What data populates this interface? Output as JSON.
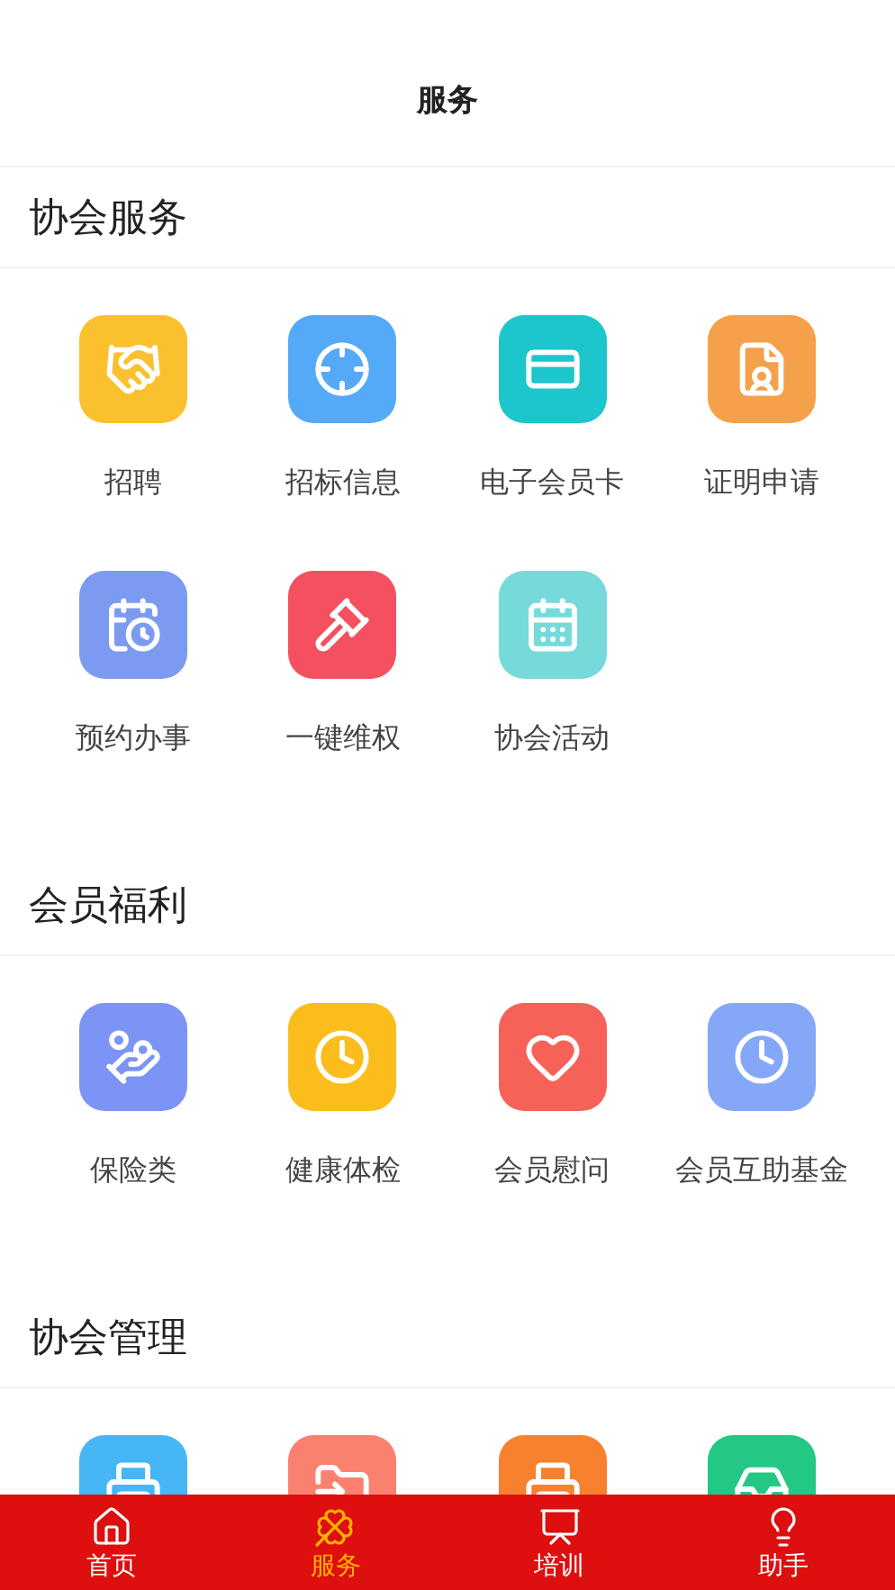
{
  "header": {
    "title": "服务"
  },
  "sections": [
    {
      "title": "协会服务",
      "items": [
        {
          "label": "招聘",
          "color": "#fbc02d"
        },
        {
          "label": "招标信息",
          "color": "#55aaf7"
        },
        {
          "label": "电子会员卡",
          "color": "#1cc6cc"
        },
        {
          "label": "证明申请",
          "color": "#f5a04a"
        },
        {
          "label": "预约办事",
          "color": "#7c9bf0"
        },
        {
          "label": "一键维权",
          "color": "#f45060"
        },
        {
          "label": "协会活动",
          "color": "#76dada"
        }
      ]
    },
    {
      "title": "会员福利",
      "items": [
        {
          "label": "保险类",
          "color": "#7c94f5"
        },
        {
          "label": "健康体检",
          "color": "#fbbd1b"
        },
        {
          "label": "会员慰问",
          "color": "#f66258"
        },
        {
          "label": "会员互助基金",
          "color": "#84a8f7"
        }
      ]
    },
    {
      "title": "协会管理",
      "items": [
        {
          "color": "#46b6f7"
        },
        {
          "color": "#fa8170"
        },
        {
          "color": "#f7812f"
        },
        {
          "color": "#22c883"
        }
      ]
    }
  ],
  "tabs": [
    {
      "label": "首页",
      "selected": false
    },
    {
      "label": "服务",
      "selected": true
    },
    {
      "label": "培训",
      "selected": false
    },
    {
      "label": "助手",
      "selected": false
    }
  ]
}
